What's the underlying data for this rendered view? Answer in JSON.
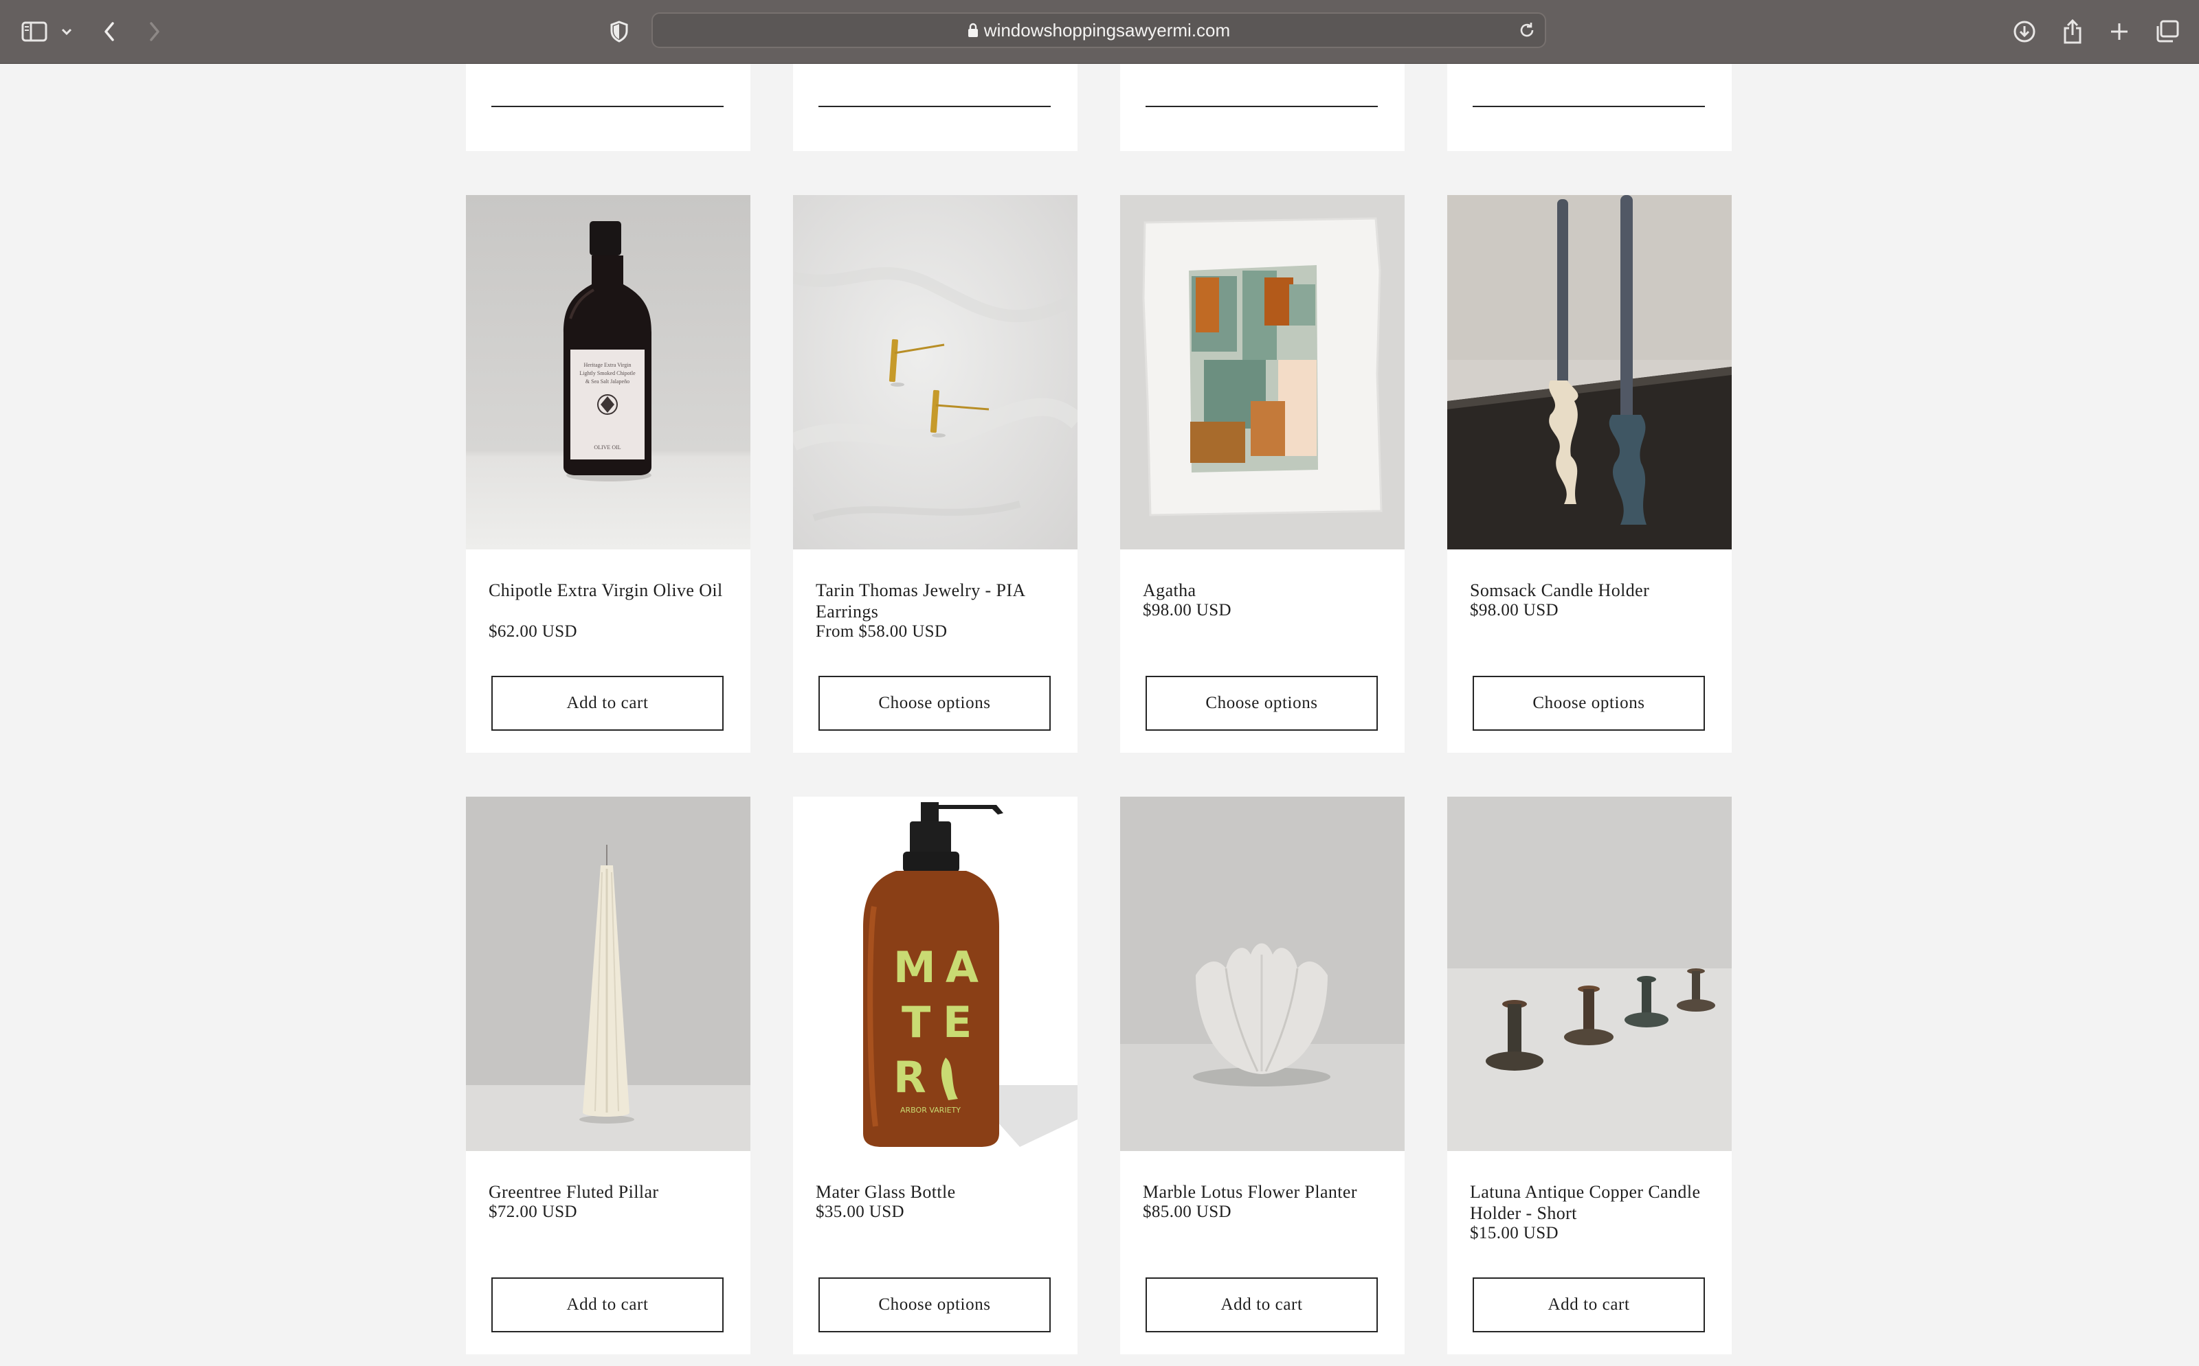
{
  "browser": {
    "url": "windowshoppingsawyermi.com",
    "toolbar_color": "#65605f"
  },
  "products": [
    {
      "title": "Chipotle Extra Virgin Olive Oil",
      "price": "$62.00 USD",
      "button": "Add to cart"
    },
    {
      "title": "Tarin Thomas Jewelry - PIA Earrings",
      "price": "From $58.00 USD",
      "button": "Choose options"
    },
    {
      "title": "Agatha",
      "price": "$98.00 USD",
      "button": "Choose options"
    },
    {
      "title": "Somsack Candle Holder",
      "price": "$98.00 USD",
      "button": "Choose options"
    },
    {
      "title": "Greentree Fluted Pillar",
      "price": "$72.00 USD",
      "button": "Add to cart"
    },
    {
      "title": "Mater Glass Bottle",
      "price": "$35.00 USD",
      "button": "Choose options"
    },
    {
      "title": "Marble Lotus Flower Planter",
      "price": "$85.00 USD",
      "button": "Add to cart"
    },
    {
      "title": "Latuna Antique Copper Candle Holder - Short",
      "price": "$15.00 USD",
      "button": "Add to cart"
    }
  ],
  "image_labels": {
    "olive_bottle": [
      "Heritage Extra Virgin",
      "Lightly Smoked Chipotle",
      "& Sea Salt Jalapeño",
      "OLIVE OIL"
    ],
    "mater_bottle": [
      "M",
      "A",
      "T",
      "E",
      "R",
      "ARBOR VARIETY"
    ]
  }
}
